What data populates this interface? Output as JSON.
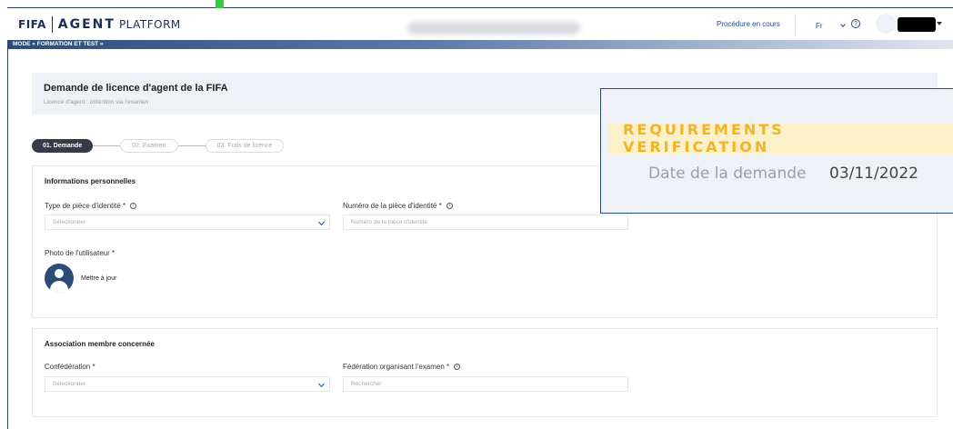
{
  "header": {
    "logo_fifa": "FIFA",
    "logo_agent": "AGENT",
    "logo_platform": "PLATFORM",
    "procedure_link": "Procédure en cours",
    "language": "Fr",
    "help": "?"
  },
  "mode_banner": "MODE « FORMATION ET TEST »",
  "page": {
    "title": "Demande de licence d'agent de la FIFA",
    "subtitle": "Licence d'agent : obtention via l'examen"
  },
  "steps": [
    {
      "label": "01. Demande"
    },
    {
      "label": "02. Examen"
    },
    {
      "label": "03. Frais de licence"
    }
  ],
  "personal_info": {
    "title": "Informations personnelles",
    "id_type_label": "Type de pièce d'identité *",
    "id_type_value": "Sélectionner",
    "id_number_label": "Numéro de la pièce d'identité *",
    "id_number_placeholder": "Numéro de la pièce d'identité",
    "photo_label": "Photo de l'utilisateur *",
    "update_label": "Mettre à jour"
  },
  "association": {
    "title": "Association membre concernée",
    "confederation_label": "Confédération *",
    "confederation_value": "Sélectionner",
    "federation_label": "Fédération organisant l'examen *",
    "federation_placeholder": "Rechercher"
  },
  "callout": {
    "badge": "REQUIREMENTS VERIFICATION",
    "date_label": "Date de la demande",
    "date_value": "03/11/2022"
  },
  "colors": {
    "navy": "#1d2c55",
    "accent": "#2c4c78",
    "badge_text": "#f0b429",
    "badge_bg": "#fbf0c8"
  }
}
